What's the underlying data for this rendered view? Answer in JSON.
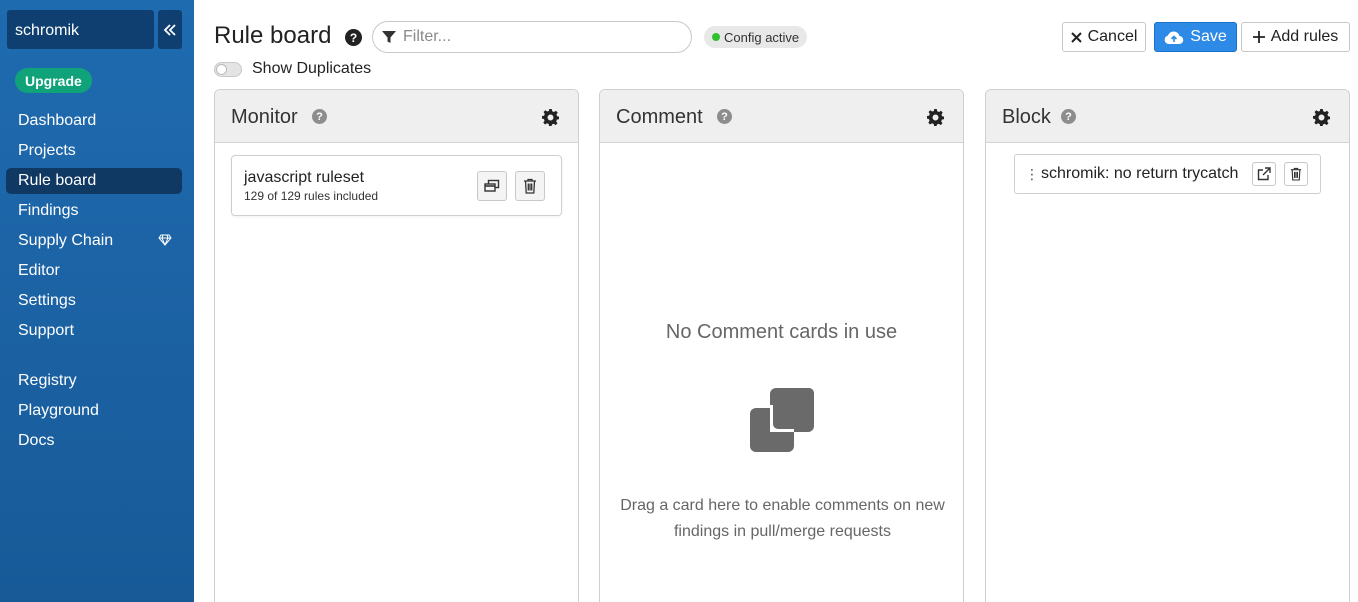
{
  "sidebar": {
    "org_name": "schromik",
    "upgrade_label": "Upgrade",
    "items": [
      {
        "label": "Dashboard"
      },
      {
        "label": "Projects"
      },
      {
        "label": "Rule board",
        "active": true
      },
      {
        "label": "Findings"
      },
      {
        "label": "Supply Chain",
        "icon": "diamond-icon"
      },
      {
        "label": "Editor"
      },
      {
        "label": "Settings"
      },
      {
        "label": "Support"
      }
    ],
    "secondary_items": [
      {
        "label": "Registry"
      },
      {
        "label": "Playground"
      },
      {
        "label": "Docs"
      }
    ]
  },
  "header": {
    "title": "Rule board",
    "filter_placeholder": "Filter...",
    "config_status": "Config active",
    "show_duplicates_label": "Show Duplicates",
    "show_duplicates_on": false,
    "cancel_label": "Cancel",
    "save_label": "Save",
    "add_rules_label": "Add rules"
  },
  "columns": {
    "monitor": {
      "title": "Monitor",
      "cards": [
        {
          "name": "javascript ruleset",
          "subtitle": "129 of 129 rules included"
        }
      ]
    },
    "comment": {
      "title": "Comment",
      "empty_title": "No Comment cards in use",
      "empty_description": "Drag a card here to enable comments on new findings in pull/merge requests"
    },
    "block": {
      "title": "Block",
      "cards": [
        {
          "name": "schromik: no return trycatch"
        }
      ]
    }
  },
  "colors": {
    "sidebar_bg": "#1f6bb0",
    "active_nav": "#0f3862",
    "upgrade_green": "#10a37a",
    "save_blue": "#2d8ae6",
    "status_green": "#2ec12e"
  }
}
